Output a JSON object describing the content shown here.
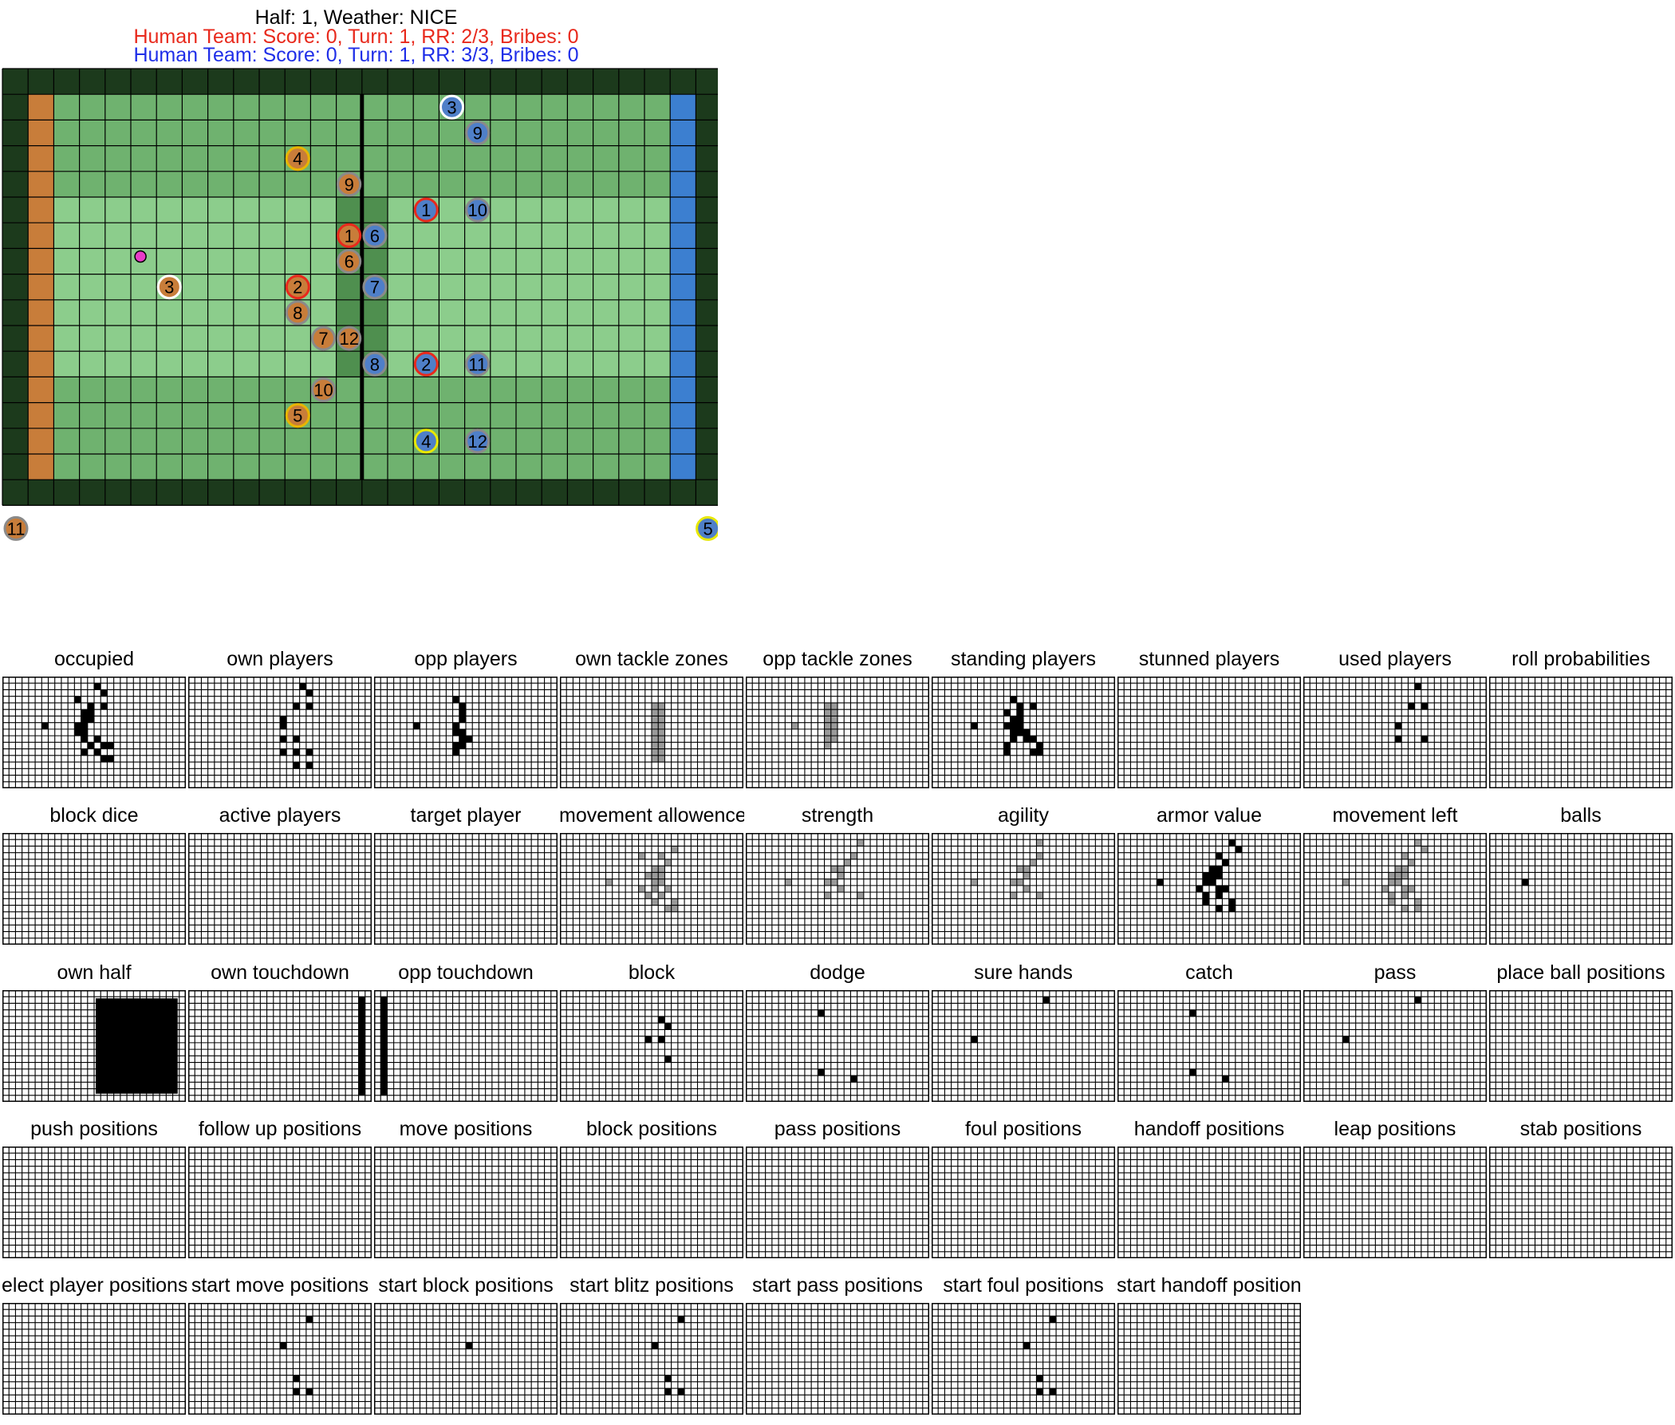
{
  "header": {
    "line1": "Half: 1, Weather: NICE",
    "red_team": "Human Team: Score: 0, Turn: 1, RR: 2/3, Bribes: 0",
    "blue_team": "Human Team: Score: 0, Turn: 1, RR: 3/3, Bribes: 0"
  },
  "colors": {
    "red_text": "#e8291c",
    "blue_text": "#1f2ee8",
    "pitch_dark": "#1c3a1c",
    "pitch_mid": "#6fb26f",
    "pitch_light": "#8ccd8c",
    "scrimmage": "#4f8f4f",
    "endzone_left": "#c87d3a",
    "endzone_right": "#3c7fd0",
    "orange_player": "#c87d3a",
    "blue_player": "#4f7fc8",
    "ball": "#e83cc8"
  },
  "pitch": {
    "cols": 28,
    "rows": 17,
    "ball": {
      "col": 5,
      "row": 7
    },
    "players": [
      {
        "team": "orange",
        "number": "4",
        "col": 11,
        "row": 3,
        "ring": "#e8b400"
      },
      {
        "team": "orange",
        "number": "9",
        "col": 13,
        "row": 4,
        "ring": "#8a8a8a"
      },
      {
        "team": "orange",
        "number": "1",
        "col": 13,
        "row": 6,
        "ring": "#e8291c"
      },
      {
        "team": "orange",
        "number": "6",
        "col": 13,
        "row": 7,
        "ring": "#8a8a8a"
      },
      {
        "team": "orange",
        "number": "3",
        "col": 6,
        "row": 8,
        "ring": "#ffffff"
      },
      {
        "team": "orange",
        "number": "2",
        "col": 11,
        "row": 8,
        "ring": "#e8291c"
      },
      {
        "team": "orange",
        "number": "8",
        "col": 11,
        "row": 9,
        "ring": "#8a8a8a"
      },
      {
        "team": "orange",
        "number": "7",
        "col": 12,
        "row": 10,
        "ring": "#8a8a8a"
      },
      {
        "team": "orange",
        "number": "12",
        "col": 13,
        "row": 10,
        "ring": "#8a8a8a"
      },
      {
        "team": "orange",
        "number": "10",
        "col": 12,
        "row": 12,
        "ring": "#8a8a8a"
      },
      {
        "team": "orange",
        "number": "5",
        "col": 11,
        "row": 13,
        "ring": "#e8b400"
      },
      {
        "team": "blue",
        "number": "3",
        "col": 17,
        "row": 1,
        "ring": "#ffffff"
      },
      {
        "team": "blue",
        "number": "9",
        "col": 18,
        "row": 2,
        "ring": "#8a8a8a"
      },
      {
        "team": "blue",
        "number": "1",
        "col": 16,
        "row": 5,
        "ring": "#e8291c"
      },
      {
        "team": "blue",
        "number": "10",
        "col": 18,
        "row": 5,
        "ring": "#8a8a8a"
      },
      {
        "team": "blue",
        "number": "6",
        "col": 14,
        "row": 6,
        "ring": "#8a8a8a"
      },
      {
        "team": "blue",
        "number": "7",
        "col": 14,
        "row": 8,
        "ring": "#8a8a8a"
      },
      {
        "team": "blue",
        "number": "8",
        "col": 14,
        "row": 11,
        "ring": "#8a8a8a"
      },
      {
        "team": "blue",
        "number": "2",
        "col": 16,
        "row": 11,
        "ring": "#e8291c"
      },
      {
        "team": "blue",
        "number": "11",
        "col": 18,
        "row": 11,
        "ring": "#8a8a8a"
      },
      {
        "team": "blue",
        "number": "4",
        "col": 16,
        "row": 14,
        "ring": "#e8e800"
      },
      {
        "team": "blue",
        "number": "12",
        "col": 18,
        "row": 14,
        "ring": "#8a8a8a"
      }
    ],
    "reserves": [
      {
        "team": "orange",
        "number": "11",
        "ring": "#8a8a8a",
        "side": "left"
      },
      {
        "team": "blue",
        "number": "5",
        "ring": "#e8e800",
        "side": "right"
      }
    ]
  },
  "feature_grid": {
    "cols": 28,
    "rows": 17
  },
  "features": [
    {
      "label": "occupied",
      "cells": [
        [
          14,
          1
        ],
        [
          15,
          2
        ],
        [
          11,
          3
        ],
        [
          13,
          4
        ],
        [
          15,
          4
        ],
        [
          6,
          7
        ],
        [
          12,
          5
        ],
        [
          13,
          5
        ],
        [
          12,
          6
        ],
        [
          13,
          6
        ],
        [
          11,
          7
        ],
        [
          12,
          7
        ],
        [
          11,
          8
        ],
        [
          12,
          8
        ],
        [
          14,
          9
        ],
        [
          12,
          9
        ],
        [
          13,
          10
        ],
        [
          15,
          10
        ],
        [
          16,
          10
        ],
        [
          12,
          11
        ],
        [
          14,
          11
        ],
        [
          15,
          12
        ],
        [
          16,
          12
        ]
      ]
    },
    {
      "label": "own players",
      "cells": [
        [
          17,
          1
        ],
        [
          18,
          2
        ],
        [
          16,
          4
        ],
        [
          18,
          4
        ],
        [
          14,
          6
        ],
        [
          14,
          7
        ],
        [
          14,
          9
        ],
        [
          16,
          9
        ],
        [
          14,
          11
        ],
        [
          16,
          11
        ],
        [
          18,
          11
        ],
        [
          16,
          13
        ],
        [
          18,
          13
        ]
      ]
    },
    {
      "label": "opp players",
      "cells": [
        [
          12,
          3
        ],
        [
          13,
          4
        ],
        [
          13,
          5
        ],
        [
          13,
          6
        ],
        [
          6,
          7
        ],
        [
          12,
          7
        ],
        [
          12,
          8
        ],
        [
          13,
          8
        ],
        [
          13,
          9
        ],
        [
          14,
          9
        ],
        [
          12,
          10
        ],
        [
          13,
          10
        ],
        [
          12,
          11
        ]
      ]
    },
    {
      "label": "own tackle zones",
      "shade": true,
      "cells": [
        [
          14,
          4
        ],
        [
          15,
          4
        ],
        [
          14,
          5
        ],
        [
          15,
          5
        ],
        [
          14,
          6
        ],
        [
          15,
          6
        ],
        [
          14,
          7
        ],
        [
          15,
          7
        ],
        [
          14,
          8
        ],
        [
          15,
          8
        ],
        [
          14,
          9
        ],
        [
          15,
          9
        ],
        [
          14,
          10
        ],
        [
          15,
          10
        ],
        [
          14,
          11
        ],
        [
          15,
          11
        ],
        [
          14,
          12
        ],
        [
          15,
          12
        ]
      ]
    },
    {
      "label": "opp tackle zones",
      "shade": true,
      "cells": [
        [
          12,
          4
        ],
        [
          13,
          4
        ],
        [
          12,
          5
        ],
        [
          13,
          5
        ],
        [
          12,
          6
        ],
        [
          13,
          6
        ],
        [
          12,
          7
        ],
        [
          13,
          7
        ],
        [
          12,
          8
        ],
        [
          13,
          8
        ],
        [
          7,
          7
        ],
        [
          12,
          9
        ],
        [
          13,
          9
        ],
        [
          12,
          10
        ]
      ]
    },
    {
      "label": "standing players",
      "cells": [
        [
          12,
          3
        ],
        [
          13,
          4
        ],
        [
          15,
          4
        ],
        [
          6,
          7
        ],
        [
          11,
          5
        ],
        [
          13,
          5
        ],
        [
          12,
          6
        ],
        [
          13,
          6
        ],
        [
          11,
          7
        ],
        [
          12,
          7
        ],
        [
          13,
          7
        ],
        [
          12,
          8
        ],
        [
          13,
          8
        ],
        [
          14,
          8
        ],
        [
          12,
          9
        ],
        [
          14,
          9
        ],
        [
          15,
          9
        ],
        [
          11,
          10
        ],
        [
          16,
          10
        ],
        [
          11,
          11
        ],
        [
          15,
          11
        ],
        [
          16,
          11
        ]
      ]
    },
    {
      "label": "stunned players",
      "cells": []
    },
    {
      "label": "used players",
      "cells": [
        [
          17,
          1
        ],
        [
          16,
          4
        ],
        [
          18,
          4
        ],
        [
          14,
          7
        ],
        [
          14,
          9
        ],
        [
          18,
          9
        ]
      ]
    },
    {
      "label": "roll probabilities",
      "cells": []
    },
    {
      "label": "block dice",
      "cells": []
    },
    {
      "label": "active players",
      "cells": []
    },
    {
      "label": "target player",
      "cells": []
    },
    {
      "label": "movement allowence",
      "shade": true,
      "cells": [
        [
          12,
          3
        ],
        [
          15,
          3
        ],
        [
          17,
          2
        ],
        [
          16,
          4
        ],
        [
          14,
          5
        ],
        [
          15,
          5
        ],
        [
          13,
          6
        ],
        [
          14,
          6
        ],
        [
          15,
          6
        ],
        [
          7,
          7
        ],
        [
          14,
          7
        ],
        [
          15,
          7
        ],
        [
          12,
          8
        ],
        [
          14,
          8
        ],
        [
          16,
          8
        ],
        [
          13,
          9
        ],
        [
          15,
          9
        ],
        [
          14,
          10
        ],
        [
          17,
          10
        ],
        [
          16,
          11
        ],
        [
          17,
          11
        ]
      ]
    },
    {
      "label": "strength",
      "shade": true,
      "cells": [
        [
          17,
          1
        ],
        [
          16,
          3
        ],
        [
          15,
          4
        ],
        [
          13,
          5
        ],
        [
          14,
          5
        ],
        [
          14,
          6
        ],
        [
          6,
          7
        ],
        [
          12,
          7
        ],
        [
          13,
          7
        ],
        [
          14,
          8
        ],
        [
          12,
          9
        ],
        [
          17,
          9
        ]
      ]
    },
    {
      "label": "agility",
      "shade": true,
      "cells": [
        [
          16,
          1
        ],
        [
          16,
          3
        ],
        [
          15,
          4
        ],
        [
          13,
          5
        ],
        [
          14,
          5
        ],
        [
          14,
          6
        ],
        [
          6,
          7
        ],
        [
          12,
          7
        ],
        [
          13,
          7
        ],
        [
          14,
          8
        ],
        [
          12,
          9
        ],
        [
          16,
          9
        ]
      ]
    },
    {
      "label": "armor value",
      "cells": [
        [
          17,
          1
        ],
        [
          18,
          2
        ],
        [
          15,
          3
        ],
        [
          16,
          4
        ],
        [
          14,
          5
        ],
        [
          15,
          5
        ],
        [
          13,
          6
        ],
        [
          14,
          6
        ],
        [
          15,
          6
        ],
        [
          6,
          7
        ],
        [
          13,
          7
        ],
        [
          14,
          7
        ],
        [
          12,
          8
        ],
        [
          15,
          8
        ],
        [
          16,
          8
        ],
        [
          13,
          9
        ],
        [
          15,
          9
        ],
        [
          13,
          10
        ],
        [
          17,
          10
        ],
        [
          15,
          11
        ],
        [
          17,
          11
        ]
      ]
    },
    {
      "label": "movement left",
      "shade": true,
      "cells": [
        [
          17,
          1
        ],
        [
          18,
          2
        ],
        [
          15,
          3
        ],
        [
          16,
          4
        ],
        [
          14,
          5
        ],
        [
          15,
          5
        ],
        [
          13,
          6
        ],
        [
          14,
          6
        ],
        [
          15,
          6
        ],
        [
          6,
          7
        ],
        [
          13,
          7
        ],
        [
          14,
          7
        ],
        [
          12,
          8
        ],
        [
          15,
          8
        ],
        [
          16,
          8
        ],
        [
          13,
          9
        ],
        [
          15,
          9
        ],
        [
          13,
          10
        ],
        [
          17,
          10
        ],
        [
          15,
          11
        ],
        [
          17,
          11
        ]
      ]
    },
    {
      "label": "balls",
      "cells": [
        [
          5,
          7
        ]
      ]
    },
    {
      "label": "own half",
      "block": true,
      "cells": []
    },
    {
      "label": "own touchdown",
      "column": 26,
      "cells": []
    },
    {
      "label": "opp touchdown",
      "column": 1,
      "cells": []
    },
    {
      "label": "block",
      "cells": [
        [
          15,
          4
        ],
        [
          16,
          5
        ],
        [
          13,
          7
        ],
        [
          15,
          7
        ],
        [
          16,
          10
        ]
      ]
    },
    {
      "label": "dodge",
      "cells": [
        [
          11,
          3
        ],
        [
          11,
          12
        ],
        [
          16,
          13
        ]
      ]
    },
    {
      "label": "sure hands",
      "cells": [
        [
          17,
          1
        ],
        [
          6,
          7
        ]
      ]
    },
    {
      "label": "catch",
      "cells": [
        [
          11,
          3
        ],
        [
          11,
          12
        ],
        [
          16,
          13
        ]
      ]
    },
    {
      "label": "pass",
      "cells": [
        [
          17,
          1
        ],
        [
          6,
          7
        ]
      ]
    },
    {
      "label": "place ball positions",
      "cells": []
    },
    {
      "label": "push positions",
      "cells": []
    },
    {
      "label": "follow up positions",
      "cells": []
    },
    {
      "label": "move positions",
      "cells": []
    },
    {
      "label": "block positions",
      "cells": []
    },
    {
      "label": "pass positions",
      "cells": []
    },
    {
      "label": "foul positions",
      "cells": []
    },
    {
      "label": "handoff positions",
      "cells": []
    },
    {
      "label": "leap positions",
      "cells": []
    },
    {
      "label": "stab positions",
      "cells": []
    },
    {
      "label": "elect player positions",
      "cells": []
    },
    {
      "label": "start move positions",
      "cells": [
        [
          18,
          2
        ],
        [
          14,
          6
        ],
        [
          16,
          11
        ],
        [
          16,
          13
        ],
        [
          18,
          13
        ]
      ]
    },
    {
      "label": "start block positions",
      "cells": [
        [
          14,
          6
        ]
      ]
    },
    {
      "label": "start blitz positions",
      "cells": [
        [
          18,
          2
        ],
        [
          14,
          6
        ],
        [
          16,
          11
        ],
        [
          16,
          13
        ],
        [
          18,
          13
        ]
      ]
    },
    {
      "label": "start pass positions",
      "cells": []
    },
    {
      "label": "start foul positions",
      "cells": [
        [
          18,
          2
        ],
        [
          14,
          6
        ],
        [
          16,
          11
        ],
        [
          16,
          13
        ],
        [
          18,
          13
        ]
      ]
    },
    {
      "label": "start handoff positions",
      "cells": []
    }
  ]
}
